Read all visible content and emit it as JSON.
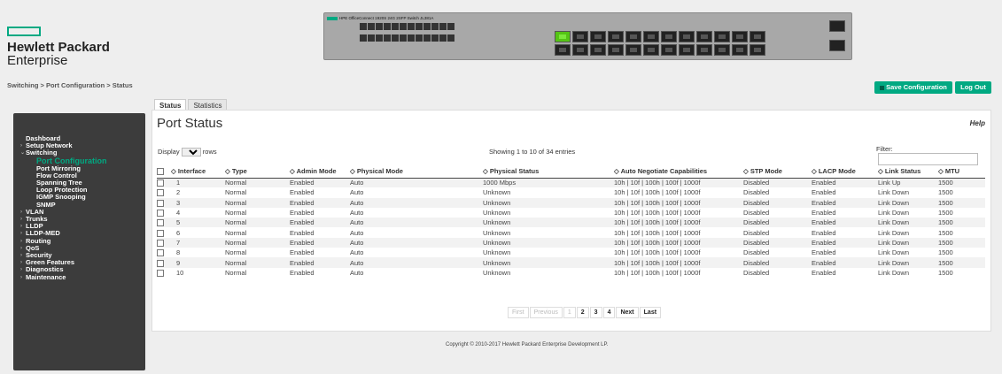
{
  "brand": {
    "line1": "Hewlett Packard",
    "line2": "Enterprise",
    "color": "#01a982"
  },
  "breadcrumb": "Switching > Port Configuration > Status",
  "switch_panel": {
    "label": "HPE OfficeConnect 1920S 24G 2SFP Switch JL381A",
    "active_port": "1"
  },
  "actions": {
    "save": "Save Configuration",
    "logout": "Log Out"
  },
  "sidebar": {
    "items": [
      {
        "label": "Dashboard",
        "chev": "",
        "level": 0
      },
      {
        "label": "Setup Network",
        "chev": "›",
        "level": 0
      },
      {
        "label": "Switching",
        "chev": "⌄",
        "level": 0
      },
      {
        "label": "Port Configuration",
        "chev": "",
        "level": 1,
        "active": true
      },
      {
        "label": "Port Mirroring",
        "chev": "",
        "level": 1
      },
      {
        "label": "Flow Control",
        "chev": "",
        "level": 1
      },
      {
        "label": "Spanning Tree",
        "chev": "",
        "level": 1
      },
      {
        "label": "Loop Protection",
        "chev": "",
        "level": 1
      },
      {
        "label": "IGMP Snooping",
        "chev": "",
        "level": 1
      },
      {
        "label": "SNMP",
        "chev": "",
        "level": 1
      },
      {
        "label": "VLAN",
        "chev": "›",
        "level": 0
      },
      {
        "label": "Trunks",
        "chev": "›",
        "level": 0
      },
      {
        "label": "LLDP",
        "chev": "›",
        "level": 0
      },
      {
        "label": "LLDP-MED",
        "chev": "›",
        "level": 0
      },
      {
        "label": "Routing",
        "chev": "›",
        "level": 0
      },
      {
        "label": "QoS",
        "chev": "›",
        "level": 0
      },
      {
        "label": "Security",
        "chev": "›",
        "level": 0
      },
      {
        "label": "Green Features",
        "chev": "›",
        "level": 0
      },
      {
        "label": "Diagnostics",
        "chev": "›",
        "level": 0
      },
      {
        "label": "Maintenance",
        "chev": "›",
        "level": 0
      }
    ]
  },
  "tabs": [
    "Status",
    "Statistics"
  ],
  "main": {
    "title": "Port Status",
    "help": "Help",
    "display_label": "Display",
    "display_value": "10",
    "rows_label": "rows",
    "showing": "Showing 1 to 10 of 34 entries",
    "filter_label": "Filter:"
  },
  "table": {
    "headers": [
      "◇ Interface",
      "◇ Type",
      "◇ Admin Mode",
      "◇ Physical Mode",
      "◇ Physical Status",
      "◇ Auto Negotiate Capabilities",
      "◇ STP Mode",
      "◇ LACP Mode",
      "◇ Link Status",
      "◇ MTU"
    ],
    "rows": [
      [
        "1",
        "Normal",
        "Enabled",
        "Auto",
        "1000 Mbps",
        "10h | 10f | 100h | 100f | 1000f",
        "Disabled",
        "Enabled",
        "Link Up",
        "1500"
      ],
      [
        "2",
        "Normal",
        "Enabled",
        "Auto",
        "Unknown",
        "10h | 10f | 100h | 100f | 1000f",
        "Disabled",
        "Enabled",
        "Link Down",
        "1500"
      ],
      [
        "3",
        "Normal",
        "Enabled",
        "Auto",
        "Unknown",
        "10h | 10f | 100h | 100f | 1000f",
        "Disabled",
        "Enabled",
        "Link Down",
        "1500"
      ],
      [
        "4",
        "Normal",
        "Enabled",
        "Auto",
        "Unknown",
        "10h | 10f | 100h | 100f | 1000f",
        "Disabled",
        "Enabled",
        "Link Down",
        "1500"
      ],
      [
        "5",
        "Normal",
        "Enabled",
        "Auto",
        "Unknown",
        "10h | 10f | 100h | 100f | 1000f",
        "Disabled",
        "Enabled",
        "Link Down",
        "1500"
      ],
      [
        "6",
        "Normal",
        "Enabled",
        "Auto",
        "Unknown",
        "10h | 10f | 100h | 100f | 1000f",
        "Disabled",
        "Enabled",
        "Link Down",
        "1500"
      ],
      [
        "7",
        "Normal",
        "Enabled",
        "Auto",
        "Unknown",
        "10h | 10f | 100h | 100f | 1000f",
        "Disabled",
        "Enabled",
        "Link Down",
        "1500"
      ],
      [
        "8",
        "Normal",
        "Enabled",
        "Auto",
        "Unknown",
        "10h | 10f | 100h | 100f | 1000f",
        "Disabled",
        "Enabled",
        "Link Down",
        "1500"
      ],
      [
        "9",
        "Normal",
        "Enabled",
        "Auto",
        "Unknown",
        "10h | 10f | 100h | 100f | 1000f",
        "Disabled",
        "Enabled",
        "Link Down",
        "1500"
      ],
      [
        "10",
        "Normal",
        "Enabled",
        "Auto",
        "Unknown",
        "10h | 10f | 100h | 100f | 1000f",
        "Disabled",
        "Enabled",
        "Link Down",
        "1500"
      ]
    ]
  },
  "pager": [
    "First",
    "Previous",
    "1",
    "2",
    "3",
    "4",
    "Next",
    "Last"
  ],
  "pager_enabled": [
    false,
    false,
    false,
    true,
    true,
    true,
    true,
    true
  ],
  "copyright": "Copyright © 2010-2017 Hewlett Packard Enterprise Development LP."
}
